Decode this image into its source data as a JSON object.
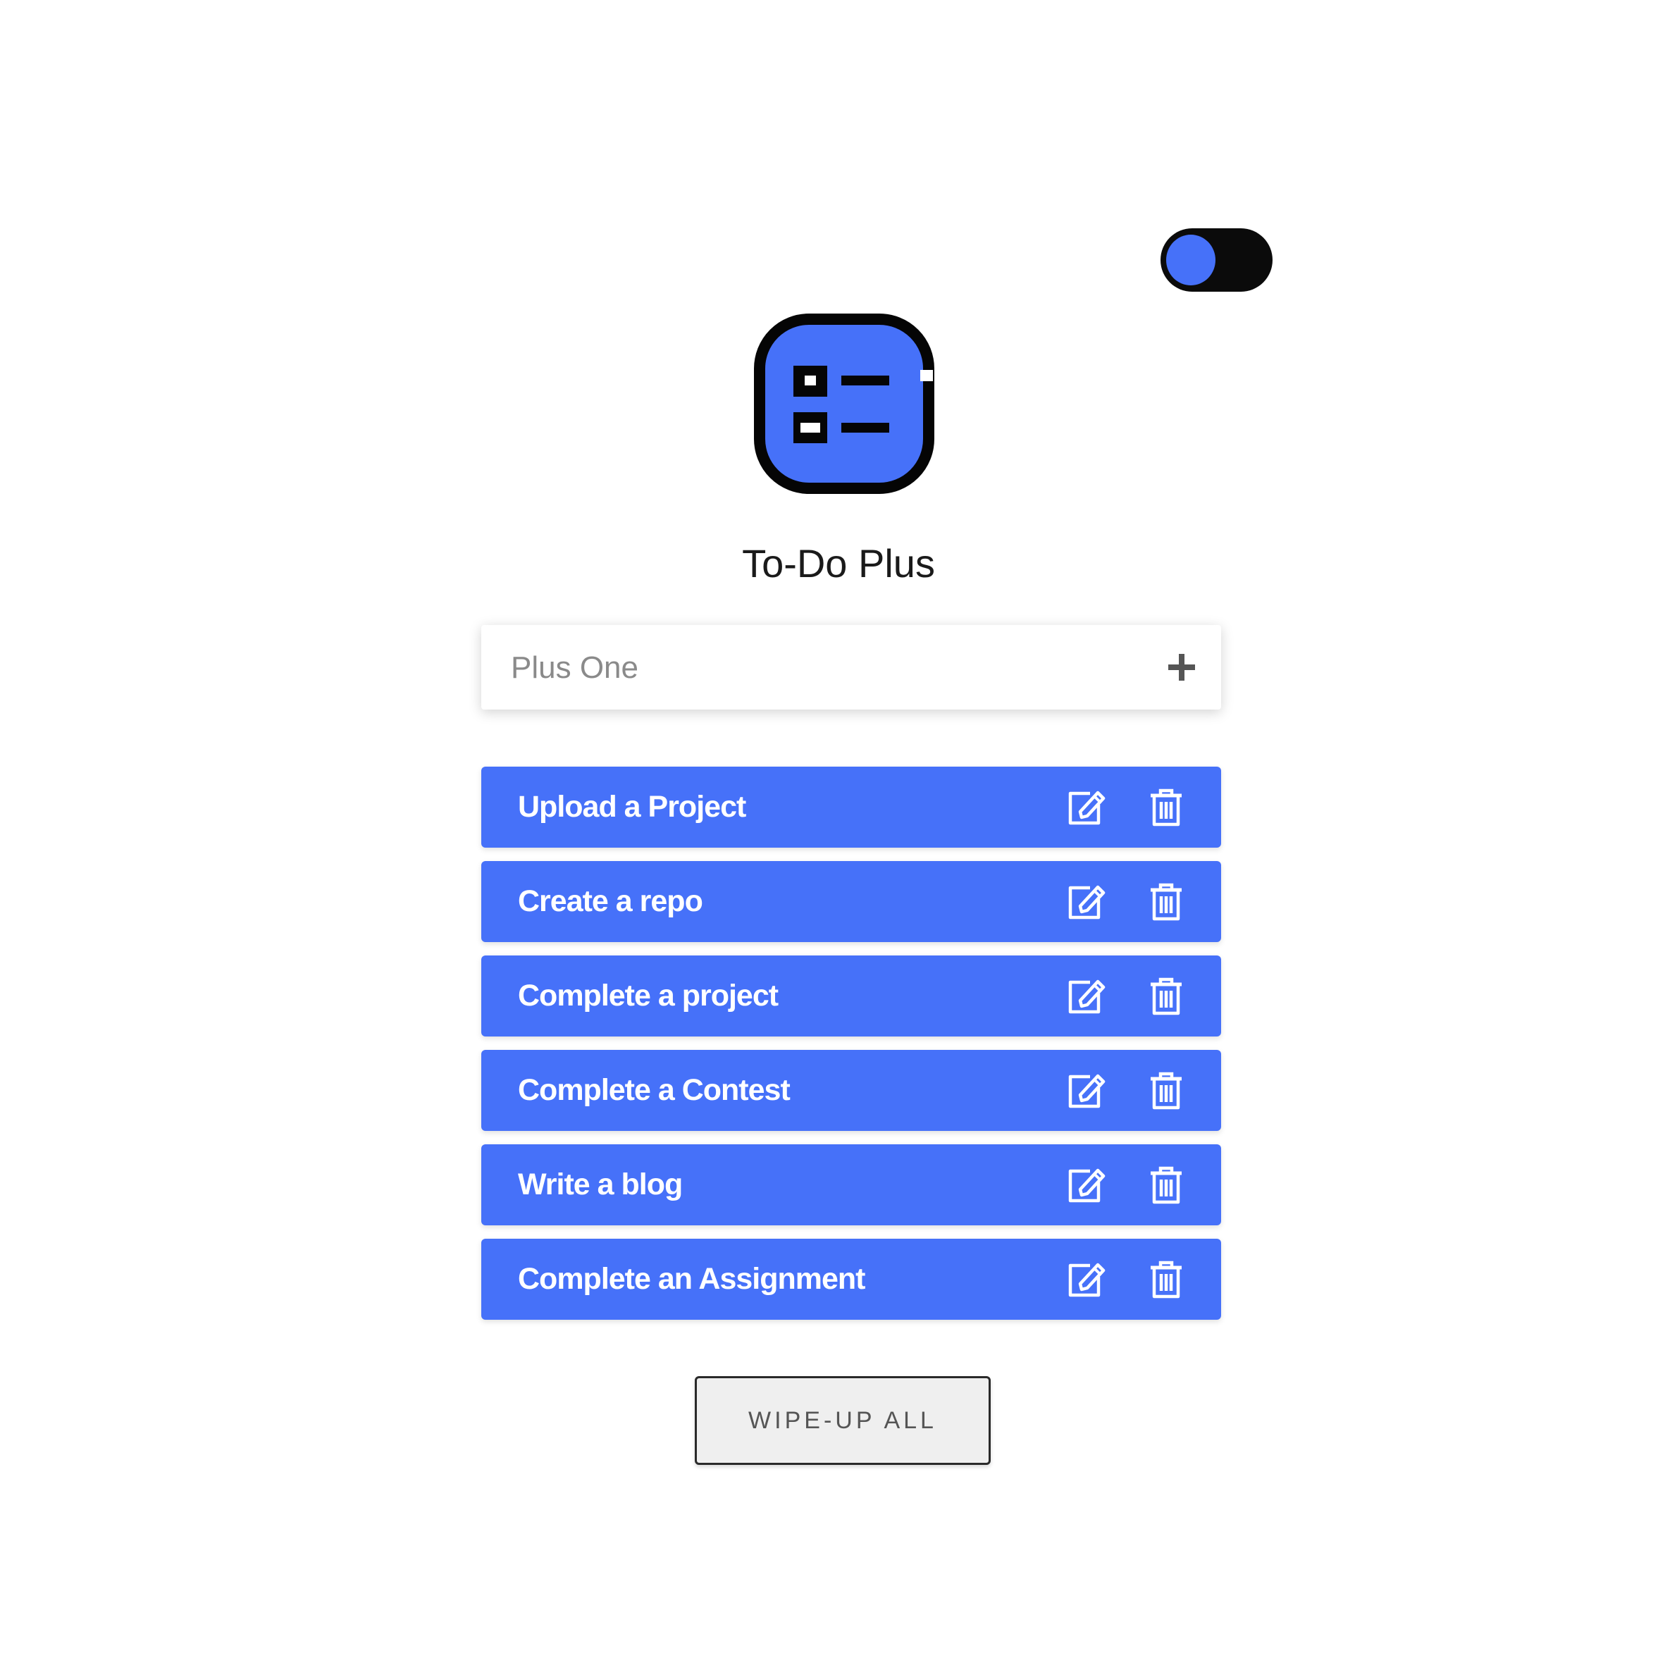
{
  "app": {
    "title": "To-Do Plus"
  },
  "theme": {
    "accent": "#4671f9",
    "toggle_track": "#0b0b0b",
    "icon_outline": "#050505"
  },
  "toggle": {
    "icon": "theme-toggle"
  },
  "logo": {
    "icon": "checklist-icon"
  },
  "input": {
    "placeholder": "Plus One",
    "value": "",
    "add_icon": "plus-icon"
  },
  "tasks": [
    {
      "label": "Upload a Project"
    },
    {
      "label": "Create a repo"
    },
    {
      "label": "Complete a project"
    },
    {
      "label": "Complete a Contest"
    },
    {
      "label": "Write a blog"
    },
    {
      "label": "Complete an Assignment"
    }
  ],
  "task_actions": {
    "edit_icon": "edit-icon",
    "delete_icon": "trash-icon"
  },
  "footer": {
    "wipe_label": "WIPE-UP ALL"
  }
}
